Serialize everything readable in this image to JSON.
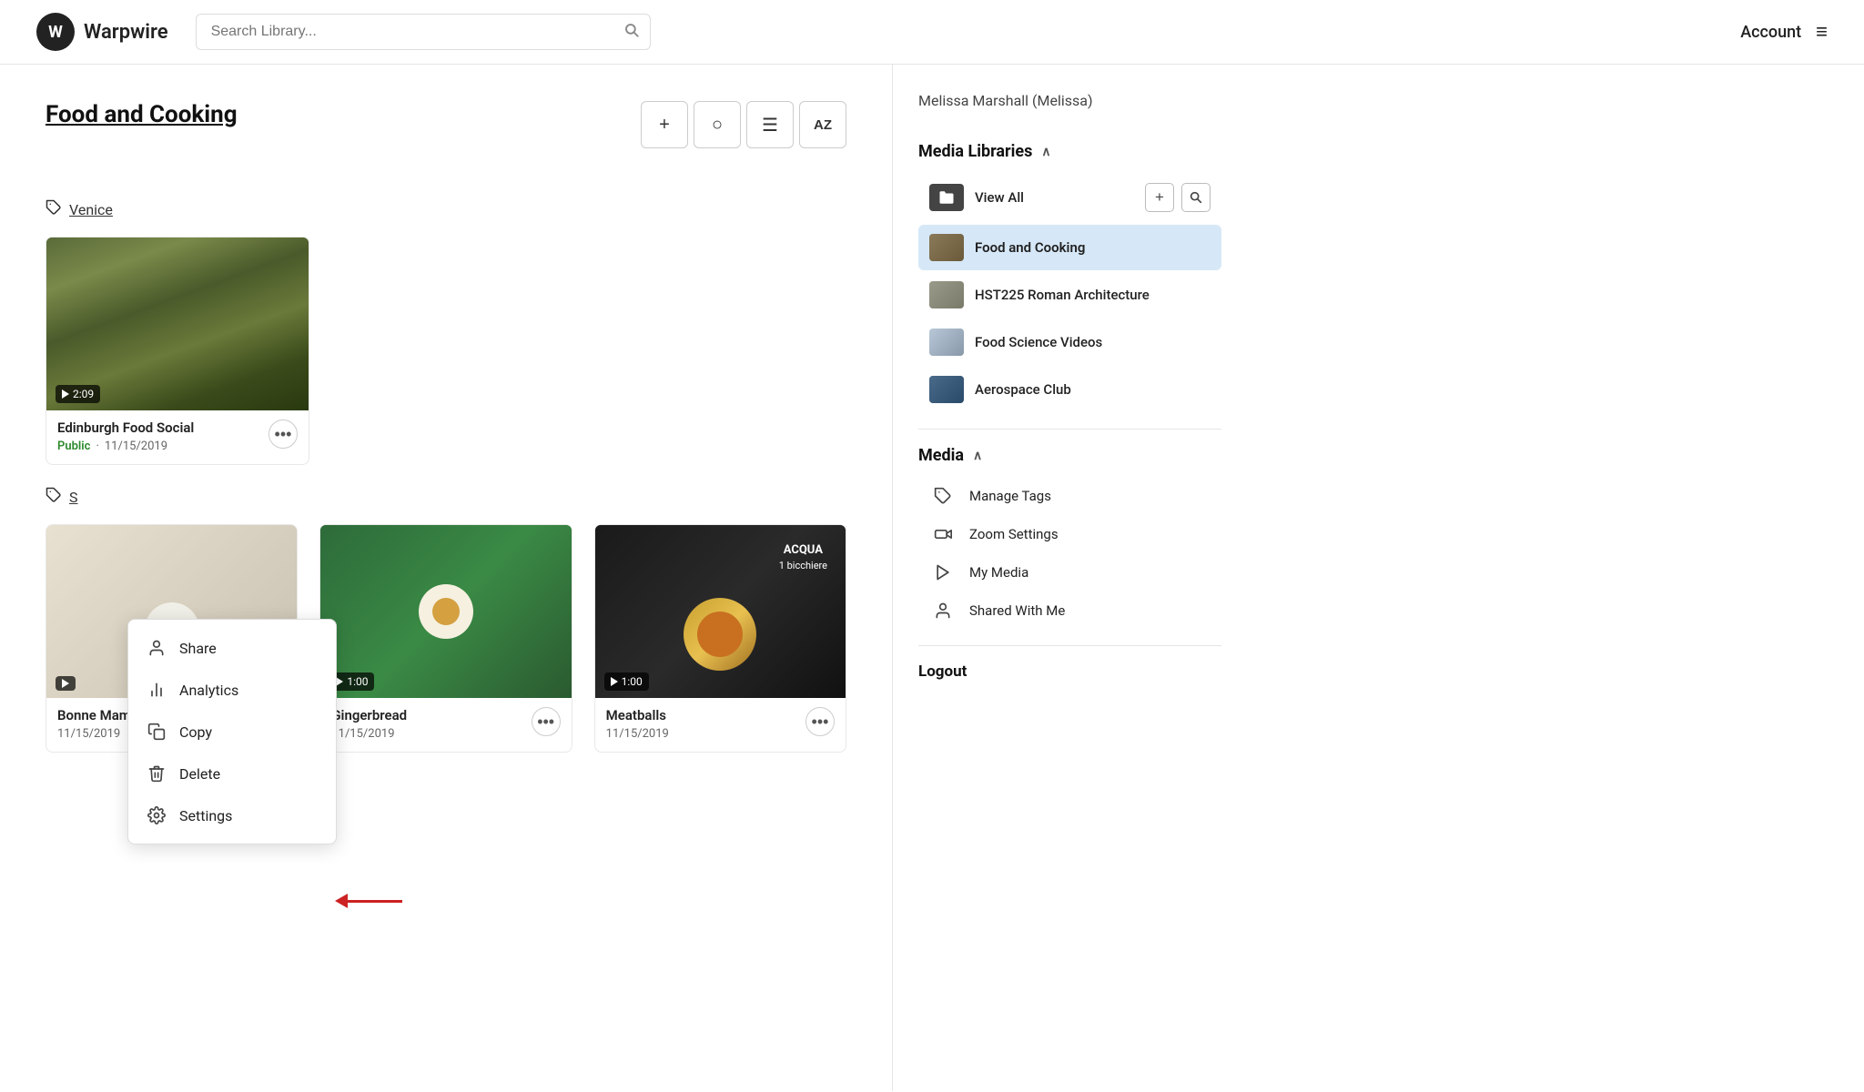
{
  "header": {
    "logo_letter": "W",
    "logo_text": "Warpwire",
    "search_placeholder": "Search Library...",
    "account_label": "Account"
  },
  "page": {
    "title": "Food and Cooking",
    "toolbar": {
      "add_label": "+",
      "circle_label": "○",
      "list_label": "☰",
      "sort_label": "AZ"
    }
  },
  "tags": {
    "tag1": "Venice",
    "tag2": "S"
  },
  "videos": [
    {
      "title": "Edinburgh Food Social",
      "status": "Public",
      "date": "11/15/2019",
      "duration": "2:09",
      "thumb_class": "video-thumb-1"
    },
    {
      "title": "Bonne Maman Blueb...",
      "status": "",
      "date": "11/15/2019",
      "duration": "",
      "thumb_class": "video-thumb-4"
    },
    {
      "title": "Gingerbread",
      "status": "",
      "date": "11/15/2019",
      "duration": "1:00",
      "thumb_class": "video-thumb-2"
    },
    {
      "title": "Meatballs",
      "status": "",
      "date": "11/15/2019",
      "duration": "1:00",
      "thumb_class": "video-thumb-3"
    }
  ],
  "context_menu": {
    "items": [
      {
        "icon": "person",
        "label": "Share"
      },
      {
        "icon": "chart",
        "label": "Analytics"
      },
      {
        "icon": "copy",
        "label": "Copy"
      },
      {
        "icon": "trash",
        "label": "Delete"
      },
      {
        "icon": "gear",
        "label": "Settings"
      }
    ]
  },
  "sidebar": {
    "user": "Melissa Marshall (Melissa)",
    "media_libraries_title": "Media Libraries",
    "libraries": [
      {
        "label": "View All",
        "is_view_all": true
      },
      {
        "label": "Food and Cooking",
        "active": true,
        "thumb": "food"
      },
      {
        "label": "HST225 Roman Architecture",
        "active": false,
        "thumb": "roman"
      },
      {
        "label": "Food Science Videos",
        "active": false,
        "thumb": "foodsci"
      },
      {
        "label": "Aerospace Club",
        "active": false,
        "thumb": "aerospace"
      }
    ],
    "media_title": "Media",
    "media_items": [
      {
        "icon": "tag",
        "label": "Manage Tags"
      },
      {
        "icon": "video",
        "label": "Zoom Settings"
      },
      {
        "icon": "play",
        "label": "My Media"
      },
      {
        "icon": "person",
        "label": "Shared With Me"
      }
    ],
    "logout_label": "Logout"
  }
}
